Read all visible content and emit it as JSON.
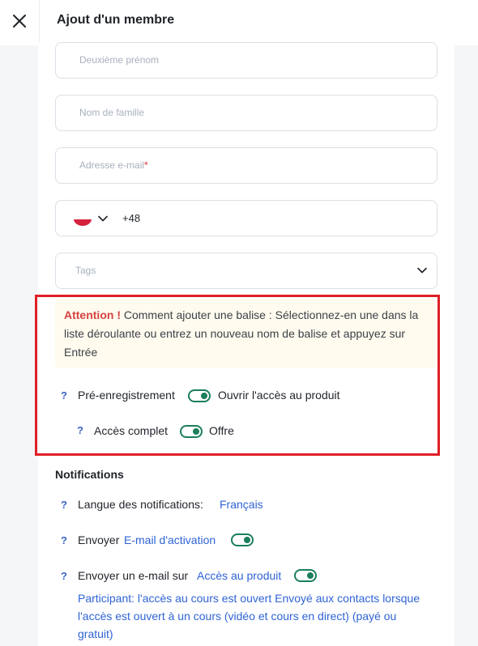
{
  "header": {
    "title": "Ajout d'un membre",
    "close_icon": "close-icon"
  },
  "form": {
    "middle_name_placeholder": "Deuxième prénom",
    "last_name_placeholder": "Nom de famille",
    "email_placeholder": "Adresse e-mail",
    "email_required_mark": "*",
    "phone": {
      "country_flag": "poland-flag-icon",
      "country_code": "+48"
    },
    "tags_placeholder": "Tags"
  },
  "notice": {
    "attention": "Attention !",
    "text": " Comment ajouter une balise : Sélectionnez-en une dans la liste déroulante ou entrez un nouveau nom de balise et appuyez sur Entrée"
  },
  "access": {
    "preregistration_label": "Pré-enregistrement",
    "preregistration_toggle_label": "Ouvrir l'accès au produit",
    "preregistration_enabled": true,
    "full_access_label": "Accès complet",
    "full_access_toggle_label": "Offre",
    "full_access_enabled": true
  },
  "notifications": {
    "title": "Notifications",
    "language_label": "Langue des notifications:",
    "language_value": "Français",
    "send_label": "Envoyer",
    "activation_email_link": "E-mail d'activation",
    "activation_email_enabled": true,
    "send_email_on_label": "Envoyer un e-mail sur",
    "product_access_link": "Accès au produit",
    "product_access_enabled": true,
    "product_access_description": "Participant: l'accès au cours est ouvert Envoyé aux contacts lorsque l'accès est ouvert à un cours (vidéo et cours en direct) (payé ou gratuit)"
  },
  "help_mark": "?",
  "colors": {
    "accent_green": "#1a7f5a",
    "link_blue": "#2f63d6",
    "highlight_red": "#e01f26",
    "attention_red": "#d64040"
  }
}
